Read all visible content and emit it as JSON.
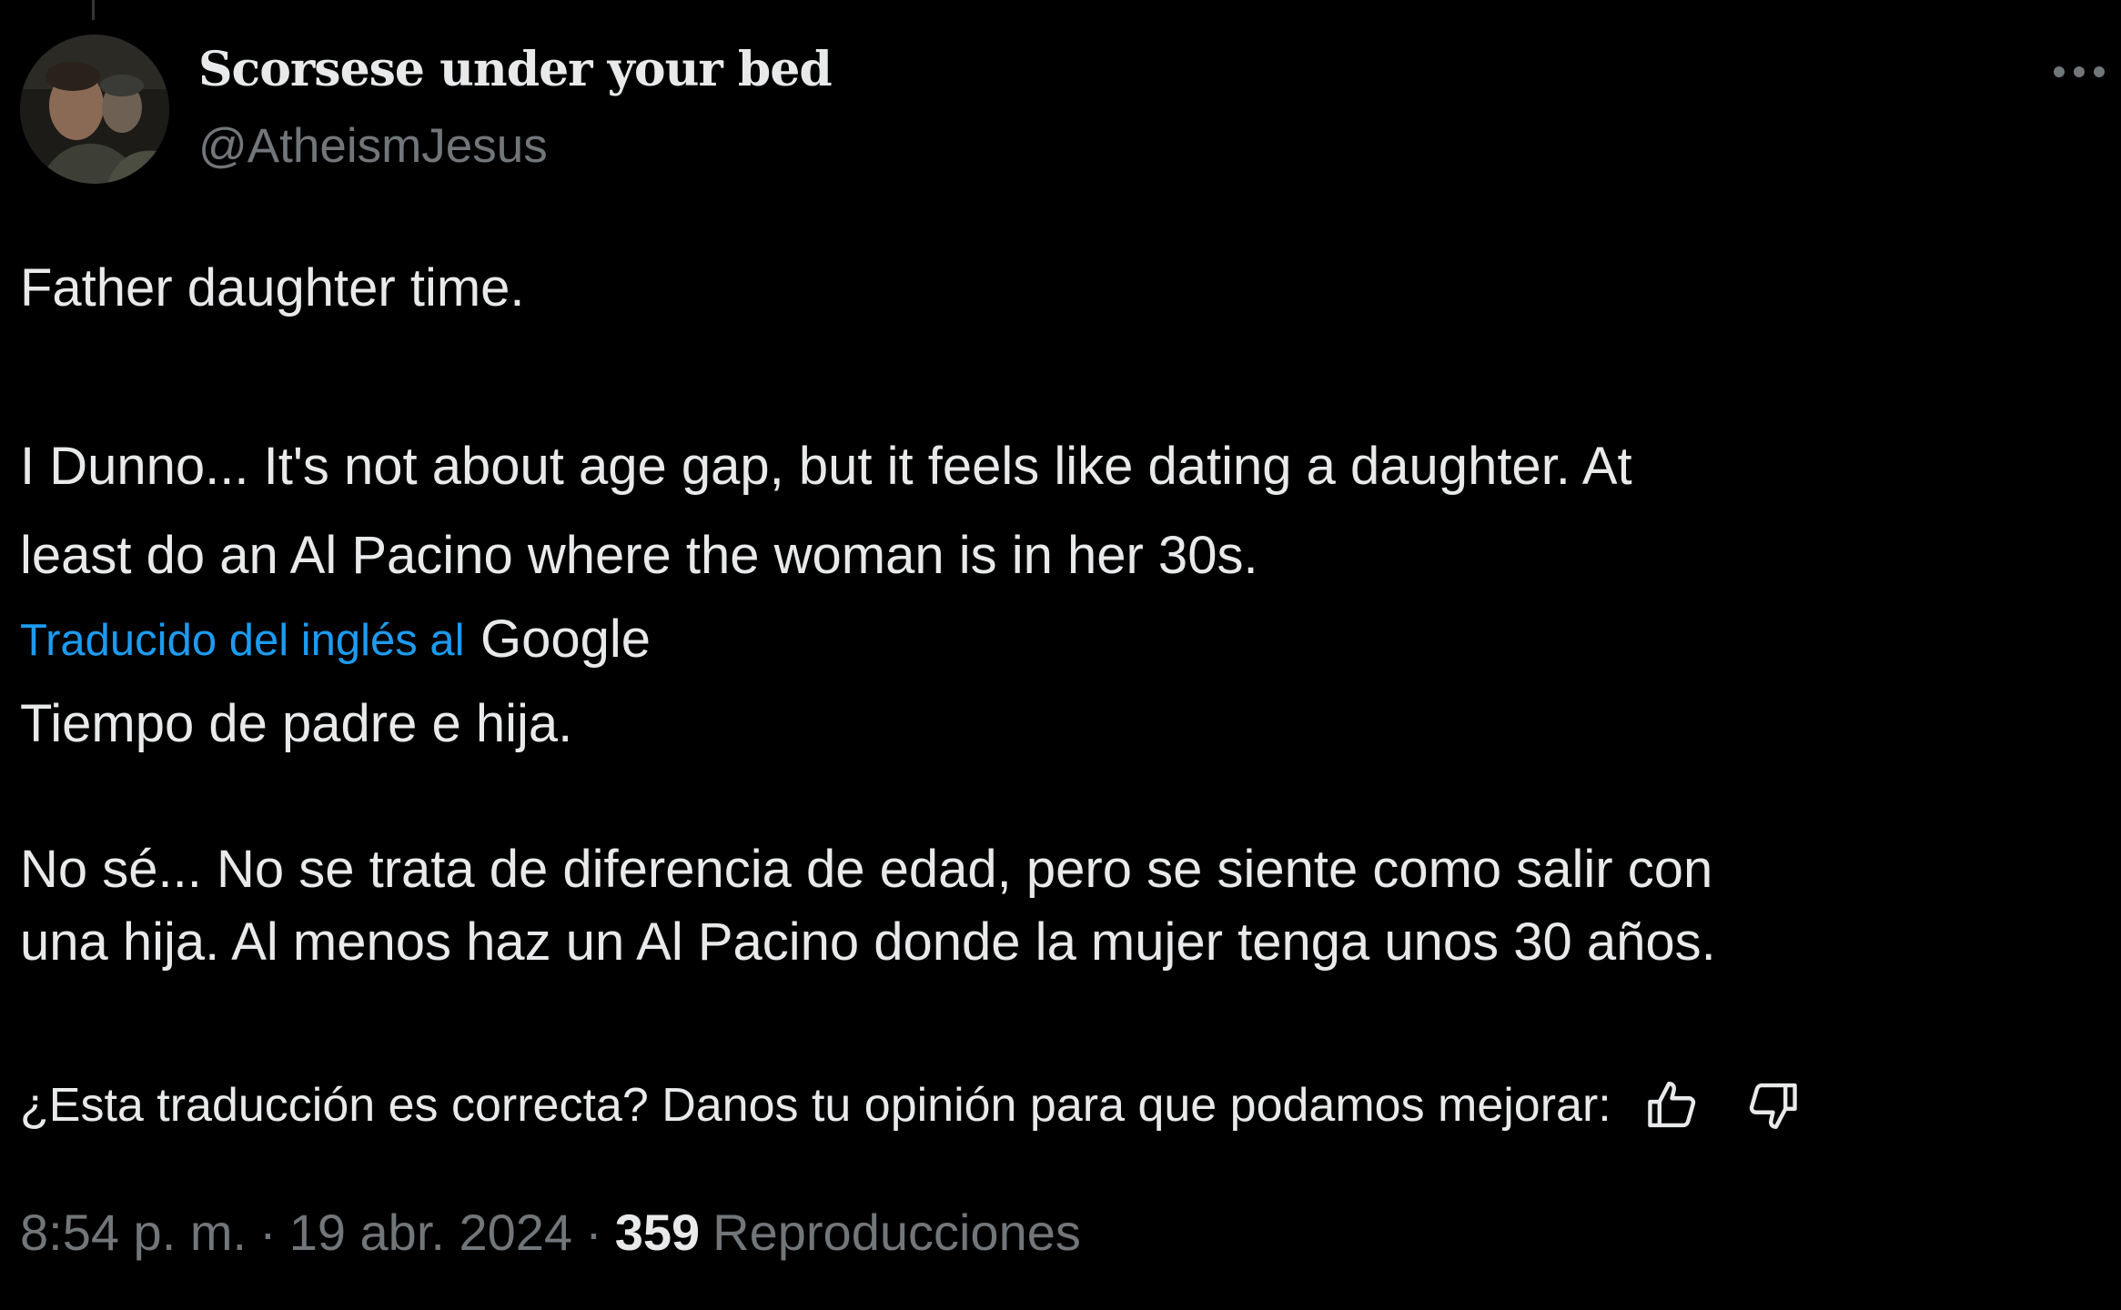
{
  "tweet": {
    "author": {
      "display_name": "Scorsese under your bed",
      "handle": "@AtheismJesus"
    },
    "original_text": {
      "line1": "Father daughter time.",
      "line2": "I Dunno... It's not about age gap, but it feels like dating a daughter. At",
      "line3": "least do an Al Pacino where the woman is in her 30s."
    },
    "translation": {
      "label": "Traducido del inglés al",
      "provider": "Google",
      "line1": "Tiempo de padre e hija.",
      "line2": "No sé... No se trata de diferencia de edad, pero se siente como salir con",
      "line3": "una hija. Al menos haz un Al Pacino donde la mujer tenga unos 30 años."
    },
    "feedback": {
      "prompt": "¿Esta traducción es correcta? Danos tu opinión para que podamos mejorar:",
      "up_icon": "thumbs-up-icon",
      "down_icon": "thumbs-down-icon"
    },
    "meta": {
      "time": "8:54 p. m.",
      "separator": "·",
      "date": "19 abr. 2024",
      "views_count": "359",
      "views_label": "Reproducciones"
    }
  },
  "colors": {
    "background": "#000000",
    "text_primary": "#e7e9ea",
    "text_secondary": "#71767b",
    "link": "#1d9bf0"
  }
}
